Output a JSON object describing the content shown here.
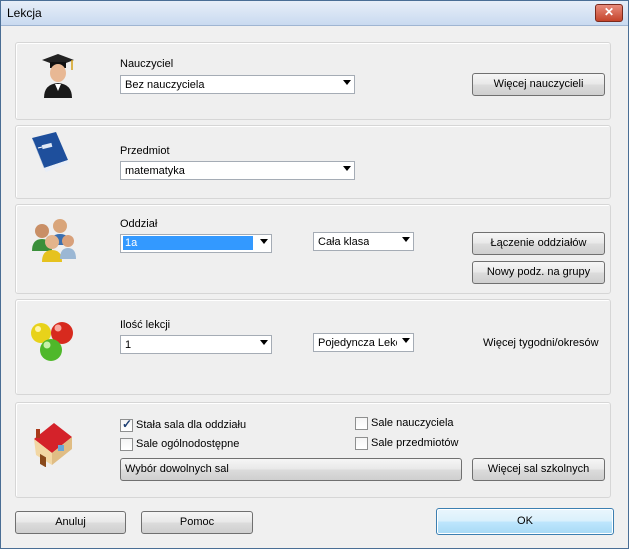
{
  "window": {
    "title": "Lekcja",
    "close_glyph": "✕"
  },
  "teacher": {
    "label": "Nauczyciel",
    "value": "Bez nauczyciela",
    "more_button": "Więcej nauczycieli",
    "icon": "teacher-graduate-icon"
  },
  "subject": {
    "label": "Przedmiot",
    "value": "matematyka",
    "icon": "book-icon"
  },
  "class": {
    "label": "Oddział",
    "value": "1a",
    "group_value": "Cała klasa",
    "merge_button": "Łączenie oddziałów",
    "new_split_button": "Nowy podz. na grupy",
    "icon": "students-group-icon"
  },
  "lessons": {
    "label": "Ilość lekcji",
    "count_value": "1",
    "type_value": "Pojedyncza Lekc",
    "more_weeks_text": "Więcej tygodni/okresów",
    "icon": "balls-icon"
  },
  "rooms": {
    "fixed_room_label": "Stała sala dla oddziału",
    "fixed_room_checked": true,
    "public_rooms_label": "Sale ogólnodostępne",
    "public_rooms_checked": false,
    "teacher_rooms_label": "Sale nauczyciela",
    "teacher_rooms_checked": false,
    "subject_rooms_label": "Sale przedmiotów",
    "subject_rooms_checked": false,
    "choose_rooms_button": "Wybór dowolnych sal",
    "more_rooms_button": "Więcej sal szkolnych",
    "icon": "house-icon"
  },
  "footer": {
    "cancel_button": "Anuluj",
    "help_button": "Pomoc",
    "ok_button": "OK"
  }
}
